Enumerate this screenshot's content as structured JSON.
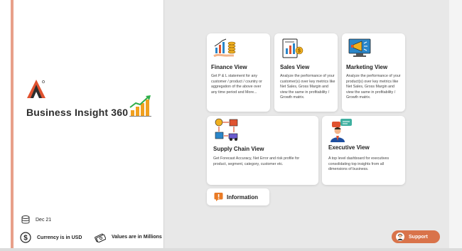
{
  "brand": {
    "title": "Business Insight 360"
  },
  "footer": {
    "date": "Dec 21",
    "currency": "Currency is in USD",
    "values": "Values are in Millions"
  },
  "cards": {
    "finance": {
      "title": "Finance View",
      "desc": "Get P & L statement for any customer / product / country or aggregation of the above over any time period and More...",
      "icon": "finance-coins-icon"
    },
    "sales": {
      "title": "Sales View",
      "desc": "Analyze the performance of your customer(s) over key metrics like Net Sales, Gross Margin and view the same in profitability / Growth matrix.",
      "icon": "sales-document-icon"
    },
    "marketing": {
      "title": "Marketing View",
      "desc": "Analyze the performance of your product(s) over key metrics like Net Sales, Gross Margin and view the same in profitability / Growth matrix.",
      "icon": "marketing-megaphone-icon"
    },
    "supply": {
      "title": "Supply Chain View",
      "desc": "Get Forecast Accuracy, Net Error and risk profile for product, segment, category, customer etc.",
      "icon": "supply-chain-icon"
    },
    "executive": {
      "title": "Executive View",
      "desc": "A top level dashboard for executives consolidating top insights from all dimensions of business.",
      "icon": "executive-presenter-icon"
    }
  },
  "information": {
    "label": "Information"
  },
  "support": {
    "label": "Support"
  },
  "colors": {
    "accent_bar": "#e8a08a",
    "support": "#d9734a",
    "logo_red": "#e0522f",
    "logo_dark": "#2d2d2d"
  }
}
